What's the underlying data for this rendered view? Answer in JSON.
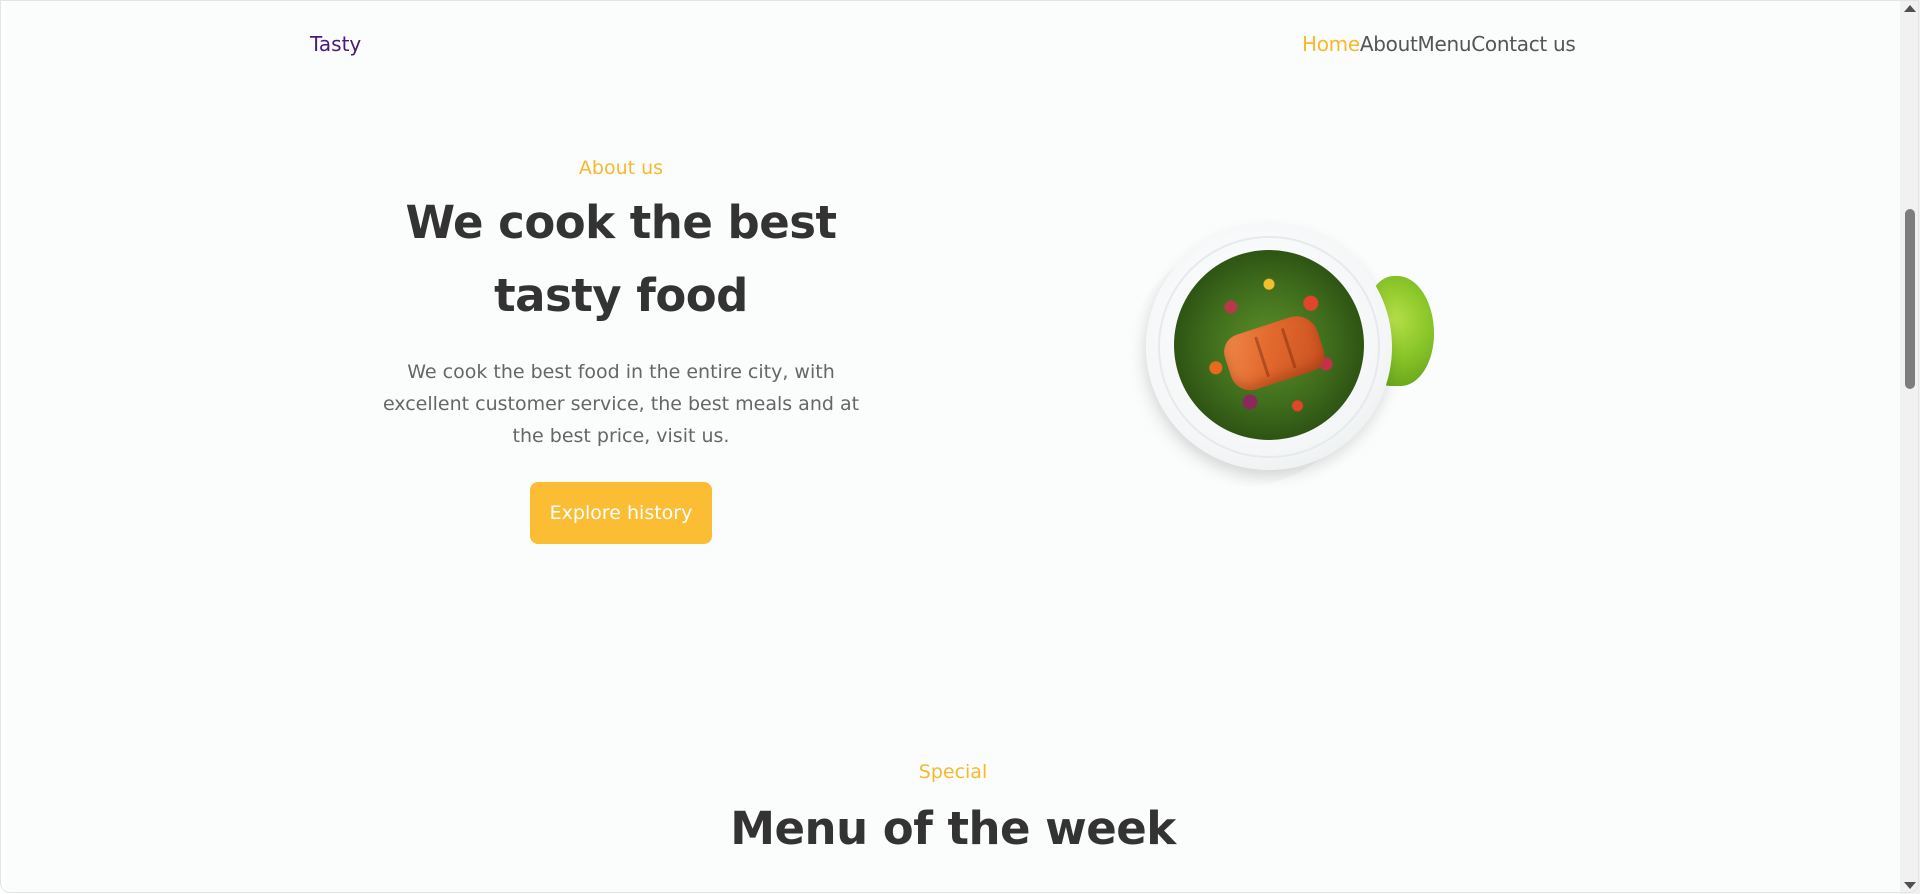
{
  "header": {
    "logo": "Tasty",
    "nav": [
      {
        "label": "Home",
        "active": true
      },
      {
        "label": "About",
        "active": false
      },
      {
        "label": "Menu",
        "active": false
      },
      {
        "label": "Contact us",
        "active": false
      }
    ]
  },
  "hero": {
    "eyebrow": "About us",
    "title_line1": "We cook the best",
    "title_line2": "tasty food",
    "description": "We cook the best food in the entire city, with excellent customer service, the best meals and at the best price, visit us.",
    "button_label": "Explore history",
    "image": "salad-plate-with-salmon"
  },
  "special": {
    "eyebrow": "Special",
    "title": "Menu of the week"
  },
  "colors": {
    "accent": "#f6b92c",
    "button": "#fbbd33",
    "logo": "#4a1a7a",
    "heading": "#333333",
    "body_text": "#666666",
    "background": "#fbfcfc"
  }
}
